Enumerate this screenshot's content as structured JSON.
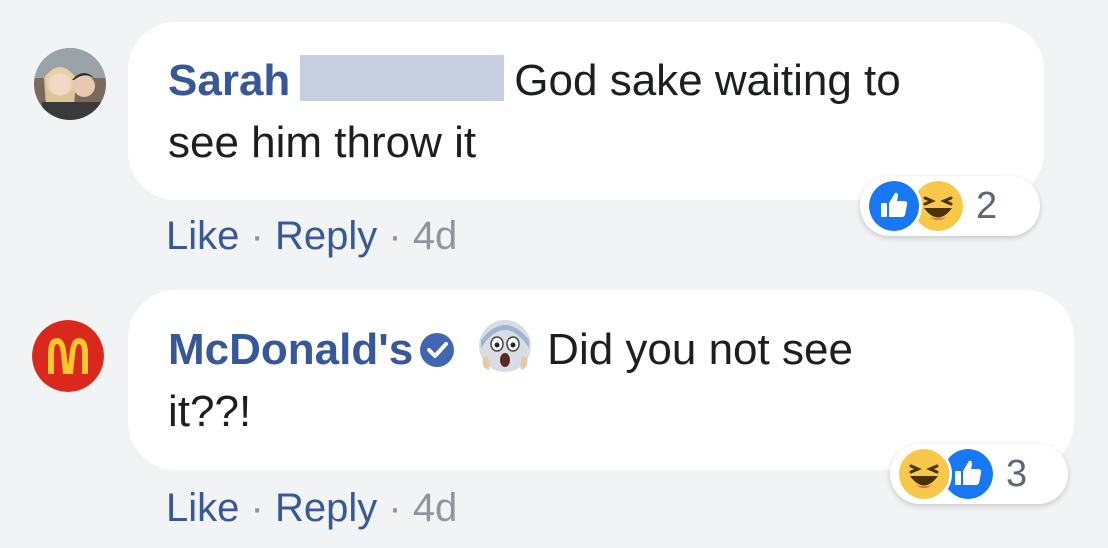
{
  "comments": [
    {
      "author": "Sarah",
      "author_redacted": true,
      "text_line1": "God sake waiting to",
      "text_line2": "see him throw it",
      "actions": {
        "like": "Like",
        "reply": "Reply",
        "separator": "·",
        "time": "4d"
      },
      "reactions": {
        "icons": [
          "like-icon",
          "haha-icon"
        ],
        "count": "2"
      },
      "avatar": "profile-photo"
    },
    {
      "author": "McDonald's",
      "verified": true,
      "emoji": "scream-emoji",
      "text_line1": "Did you not see",
      "text_line2": "it??!",
      "actions": {
        "like": "Like",
        "reply": "Reply",
        "separator": "·",
        "time": "4d"
      },
      "reactions": {
        "icons": [
          "haha-icon",
          "like-icon"
        ],
        "count": "3"
      },
      "avatar": "mcdonalds-logo"
    }
  ],
  "colors": {
    "background": "#f2f3f5",
    "bubble": "#ffffff",
    "name": "#365899",
    "link": "#385898",
    "meta": "#90949c",
    "like_blue": "#1877f2",
    "haha_yellow": "#f7c84a",
    "mcdonalds_red": "#da291c",
    "mcdonalds_yellow": "#ffc72c"
  }
}
